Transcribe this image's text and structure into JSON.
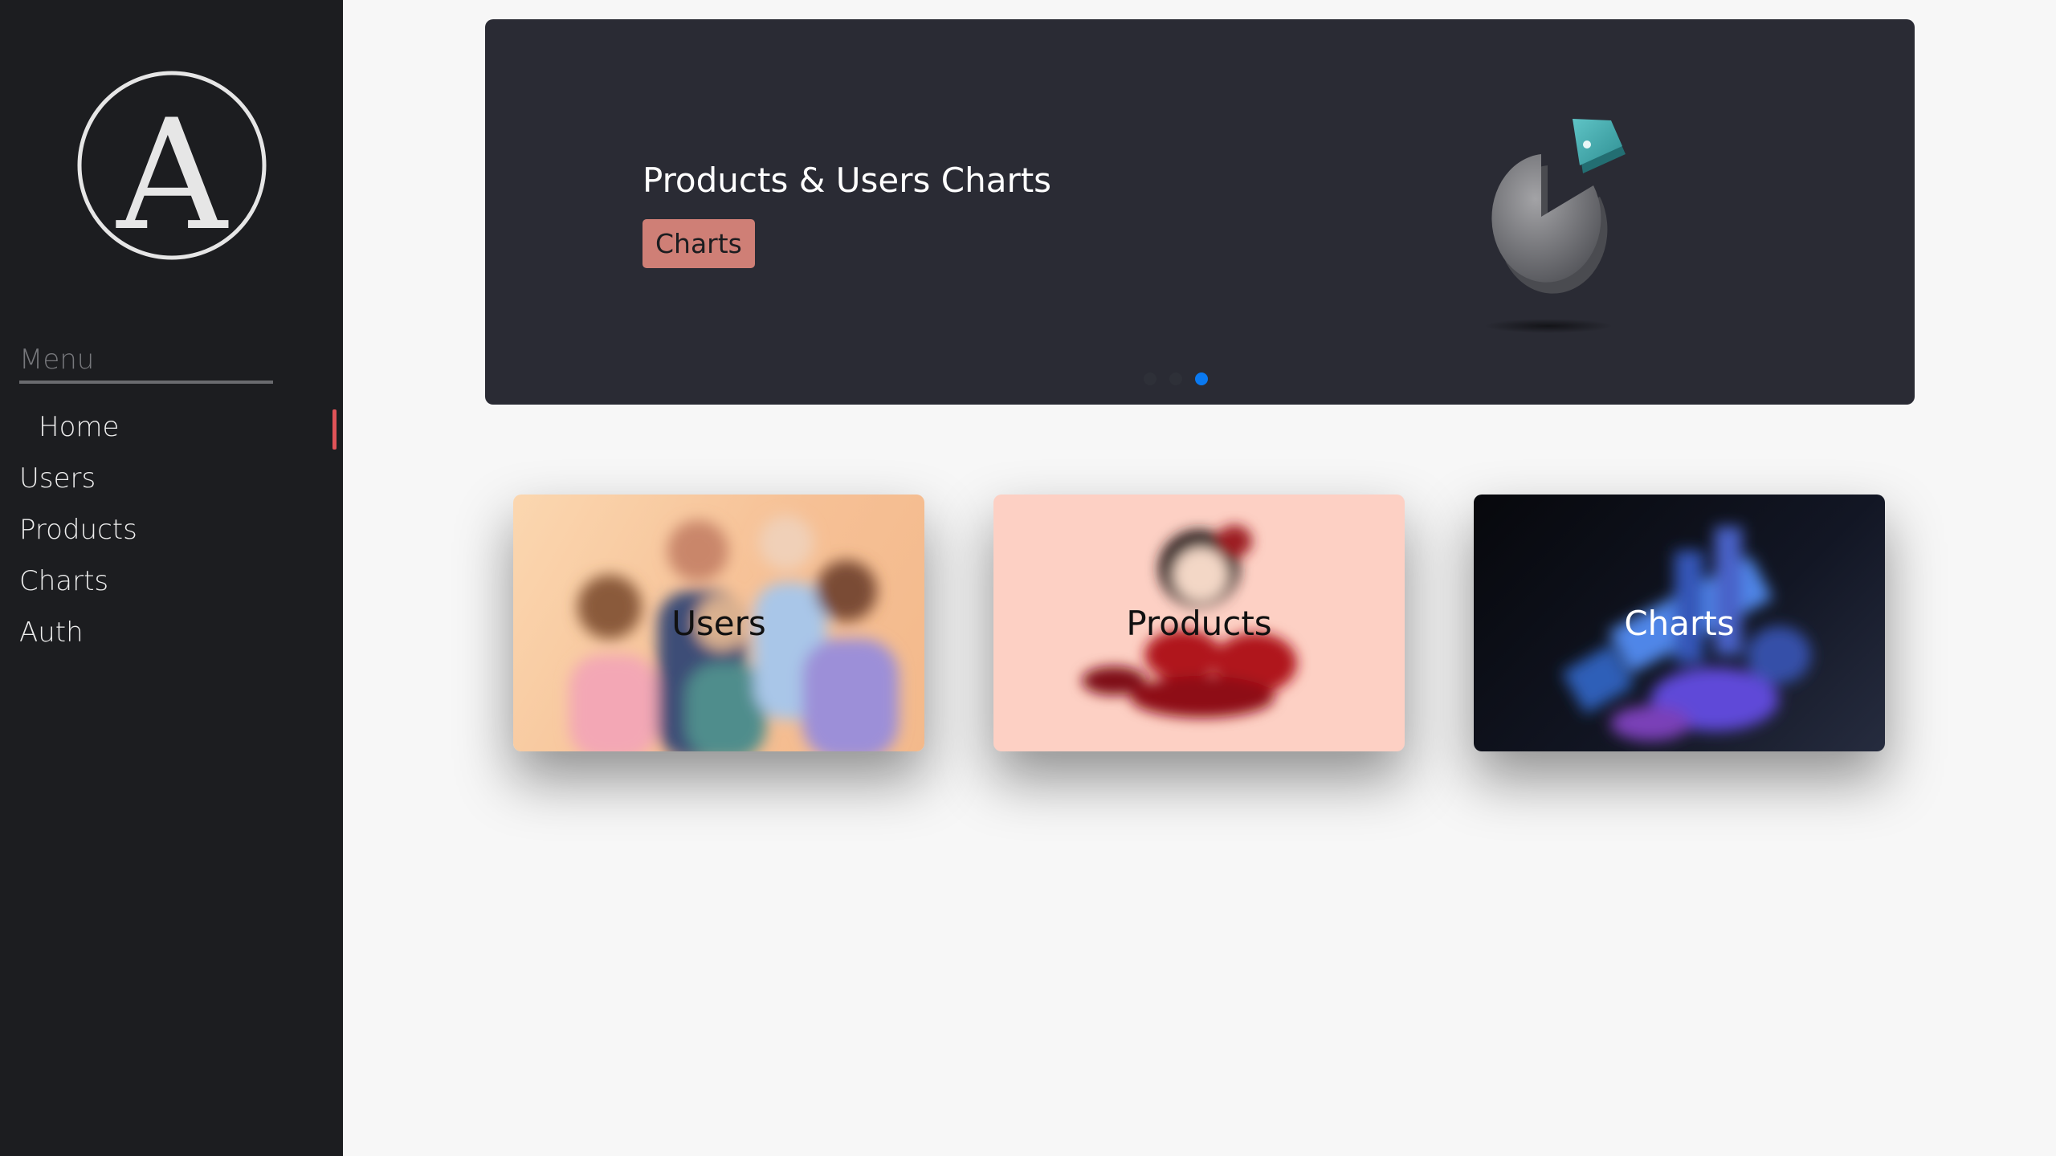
{
  "sidebar": {
    "logo_letter": "A",
    "menu_title": "Menu",
    "items": [
      {
        "label": "Home",
        "active": true
      },
      {
        "label": "Users"
      },
      {
        "label": "Products"
      },
      {
        "label": "Charts"
      },
      {
        "label": "Auth"
      }
    ]
  },
  "banner": {
    "title": "Products & Users Charts",
    "tag": "Charts",
    "illustration": "pie-chart-icon",
    "slides_total": 3,
    "active_slide": 3
  },
  "cards": [
    {
      "label": "Users"
    },
    {
      "label": "Products"
    },
    {
      "label": "Charts"
    }
  ],
  "colors": {
    "sidebar_bg": "#1c1d20",
    "banner_bg": "#2a2b34",
    "tag_bg": "#cf7f76",
    "accent_indicator": "#e05358",
    "dot_active": "#0a79f0"
  }
}
